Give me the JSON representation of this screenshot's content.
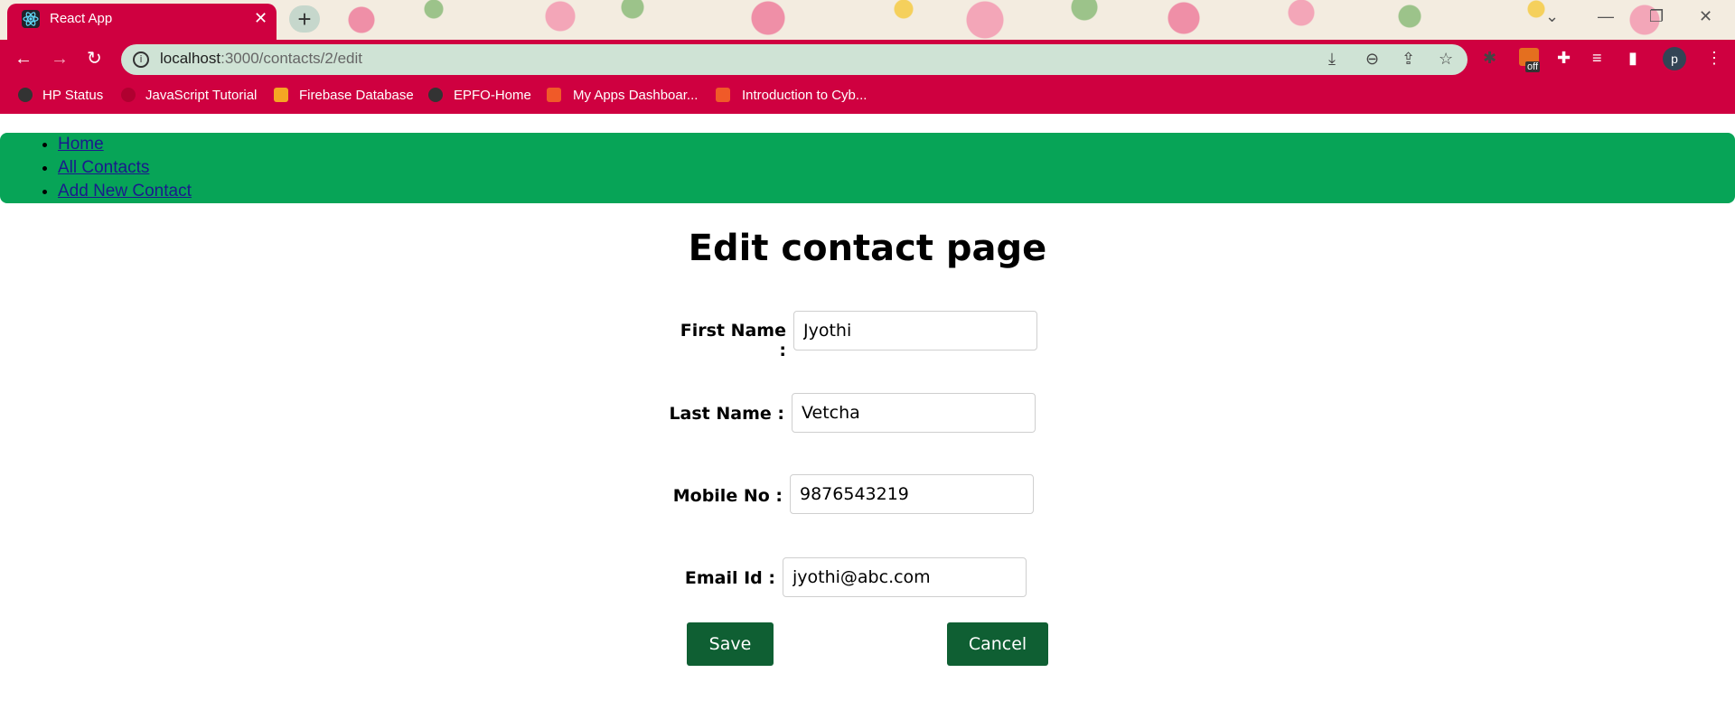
{
  "browser": {
    "tab_title": "React App",
    "tab_close": "✕",
    "new_tab": "+",
    "url_host": "localhost",
    "url_path": ":3000/contacts/2/edit",
    "profile_initial": "p",
    "extension_badge": "off",
    "bookmarks": [
      {
        "label": "HP Status"
      },
      {
        "label": "JavaScript Tutorial"
      },
      {
        "label": "Firebase Database"
      },
      {
        "label": "EPFO-Home"
      },
      {
        "label": "My Apps Dashboar..."
      },
      {
        "label": "Introduction to Cyb..."
      }
    ],
    "colors": {
      "accent": "#cf0040",
      "omnibox": "#cfe3d5"
    }
  },
  "nav": {
    "links": [
      {
        "label": "Home"
      },
      {
        "label": "All Contacts"
      },
      {
        "label": "Add New Contact"
      }
    ],
    "color": "#07a457"
  },
  "page": {
    "title": "Edit contact page",
    "form": {
      "first_name_label": "First Name :",
      "first_name_value": "Jyothi",
      "last_name_label": "Last Name :",
      "last_name_value": "Vetcha",
      "mobile_label": "Mobile No :",
      "mobile_value": "9876543219",
      "email_label": "Email Id :",
      "email_value": "jyothi@abc.com"
    },
    "buttons": {
      "save": "Save",
      "cancel": "Cancel",
      "color": "#0f5f33"
    }
  }
}
